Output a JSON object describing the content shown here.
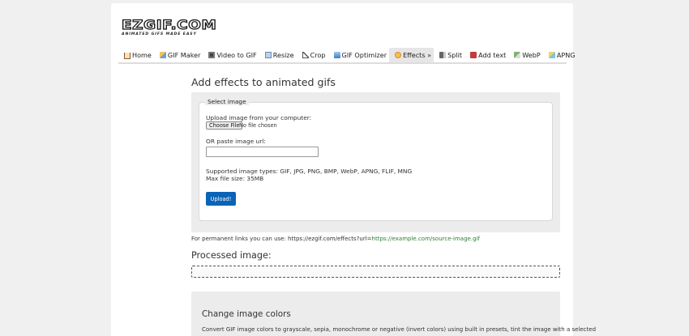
{
  "logo": {
    "main": "EZGIF.COM",
    "tagline": "ANIMATED GIFS MADE EASY"
  },
  "nav": [
    {
      "label": "Home",
      "icon": "home-icon"
    },
    {
      "label": "GIF Maker",
      "icon": "gif-maker-icon"
    },
    {
      "label": "Video to GIF",
      "icon": "video-icon"
    },
    {
      "label": "Resize",
      "icon": "resize-icon"
    },
    {
      "label": "Crop",
      "icon": "crop-icon"
    },
    {
      "label": "GIF Optimizer",
      "icon": "optimizer-icon"
    },
    {
      "label": "Effects »",
      "icon": "effects-icon",
      "active": true
    },
    {
      "label": "Split",
      "icon": "split-icon"
    },
    {
      "label": "Add text",
      "icon": "text-icon"
    },
    {
      "label": "WebP",
      "icon": "webp-icon"
    },
    {
      "label": "APNG",
      "icon": "apng-icon"
    }
  ],
  "page_title": "Add effects to animated gifs",
  "upload": {
    "legend": "Select image",
    "upload_label": "Upload image from your computer:",
    "choose_file": "Choose File",
    "no_file": "No file chosen",
    "url_label": "OR paste image url:",
    "url_value": "",
    "supported": "Supported image types: GIF, JPG, PNG, BMP, WebP, APNG, FLIF, MNG",
    "max_size": "Max file size: 35MB",
    "button": "Upload!"
  },
  "permalink": {
    "prefix": "For permanent links you can use: https://ezgif.com/effects?url=",
    "link": "https://example.com/source-image.gif"
  },
  "processed_title": "Processed image:",
  "colors_section": {
    "title": "Change image colors",
    "text": "Convert GIF image colors to grayscale, sepia, monochrome or negative (invert colors) using built in presets, tint the image with a selected"
  },
  "colors": {
    "upload_button": "#0a63b6",
    "link": "#2e7d32",
    "panel": "#ececec"
  }
}
